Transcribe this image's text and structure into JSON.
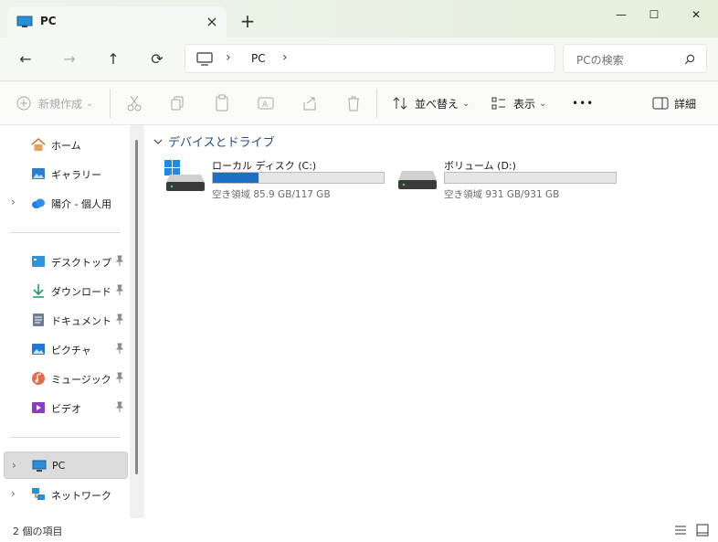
{
  "tab": {
    "title": "PC",
    "close_glyph": "×"
  },
  "new_tab_glyph": "+",
  "window": {
    "minimize": "—",
    "maximize": "☐",
    "close": "✕"
  },
  "nav": {
    "back": "←",
    "forward": "→",
    "up": "↑",
    "refresh": "⟳"
  },
  "breadcrumb": {
    "sep1": "›",
    "item": "PC",
    "sep2": "›"
  },
  "search": {
    "placeholder": "PCの検索"
  },
  "toolbar": {
    "new_label": "新規作成",
    "sort_label": "並べ替え",
    "view_label": "表示",
    "more_label": "•••",
    "details_label": "詳細",
    "dropdown": "⌄"
  },
  "sidebar": {
    "home": "ホーム",
    "gallery": "ギャラリー",
    "onedrive": "陽介 - 個人用",
    "desktop": "デスクトップ",
    "downloads": "ダウンロード",
    "documents": "ドキュメント",
    "pictures": "ピクチャ",
    "music": "ミュージック",
    "videos": "ビデオ",
    "pc": "PC",
    "network": "ネットワーク",
    "chevron": "›"
  },
  "content": {
    "group_title": "デバイスとドライブ",
    "drives": [
      {
        "name": "ローカル ディスク (C:)",
        "free_text": "空き領域 85.9 GB/117 GB",
        "used_fraction": 0.266
      },
      {
        "name": "ボリューム (D:)",
        "free_text": "空き領域 931 GB/931 GB",
        "used_fraction": 0.0
      }
    ]
  },
  "status": {
    "item_count": "2 個の項目"
  },
  "colors": {
    "accent": "#1c6fc4",
    "titlebar": "#e9f0e3",
    "selected": "#dcdcdc"
  }
}
